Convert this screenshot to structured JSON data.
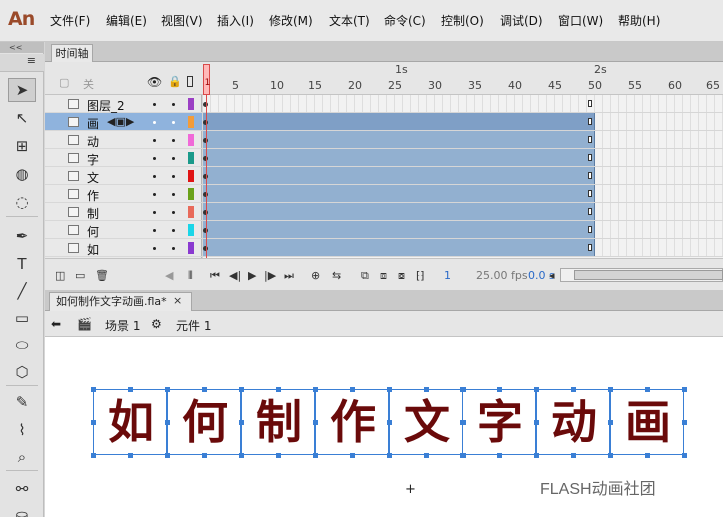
{
  "app": {
    "logo": "An"
  },
  "menu": [
    "文件(F)",
    "编辑(E)",
    "视图(V)",
    "插入(I)",
    "修改(M)",
    "文本(T)",
    "命令(C)",
    "控制(O)",
    "调试(D)",
    "窗口(W)",
    "帮助(H)"
  ],
  "toolbar": {
    "collapse": "<<",
    "grip": "≡",
    "tools": [
      {
        "name": "selection-tool-icon",
        "glyph": "➤",
        "selected": true
      },
      {
        "name": "subselection-tool-icon",
        "glyph": "↖"
      },
      {
        "name": "free-transform-tool-icon",
        "glyph": "⊞"
      },
      {
        "name": "3d-rotation-tool-icon",
        "glyph": "◍"
      },
      {
        "name": "lasso-tool-icon",
        "glyph": "◌"
      },
      {
        "name": "pen-tool-icon",
        "glyph": "✒"
      },
      {
        "name": "text-tool-icon",
        "glyph": "T"
      },
      {
        "name": "line-tool-icon",
        "glyph": "╱"
      },
      {
        "name": "rectangle-tool-icon",
        "glyph": "▭"
      },
      {
        "name": "oval-tool-icon",
        "glyph": "⬭"
      },
      {
        "name": "polystar-tool-icon",
        "glyph": "⬡"
      },
      {
        "name": "pencil-tool-icon",
        "glyph": "✎"
      },
      {
        "name": "brush-tool-icon",
        "glyph": "⌇"
      },
      {
        "name": "paint-brush-tool-icon",
        "glyph": "⌕"
      },
      {
        "name": "bone-tool-icon",
        "glyph": "⚯"
      },
      {
        "name": "paint-bucket-tool-icon",
        "glyph": "⛀"
      }
    ]
  },
  "timeline": {
    "tab": "时间轴",
    "header_label": "关",
    "ruler_seconds": [
      "1s",
      "2s"
    ],
    "ruler_frames": [
      "1",
      "5",
      "10",
      "15",
      "20",
      "25",
      "30",
      "35",
      "40",
      "45",
      "50",
      "55",
      "60",
      "65"
    ],
    "layers": [
      {
        "name": "图层_2",
        "color": "#9b3fc4",
        "active": false,
        "tween": false
      },
      {
        "name": "画",
        "color": "#f39c3a",
        "active": true,
        "tween": true
      },
      {
        "name": "动",
        "color": "#f06ad8",
        "active": false,
        "tween": true
      },
      {
        "name": "字",
        "color": "#1a9a8a",
        "active": false,
        "tween": true
      },
      {
        "name": "文",
        "color": "#e01414",
        "active": false,
        "tween": true
      },
      {
        "name": "作",
        "color": "#6aa11a",
        "active": false,
        "tween": true
      },
      {
        "name": "制",
        "color": "#e86a5a",
        "active": false,
        "tween": true
      },
      {
        "name": "何",
        "color": "#1ad6e8",
        "active": false,
        "tween": true
      },
      {
        "name": "如",
        "color": "#8a3ad0",
        "active": false,
        "tween": true
      }
    ],
    "current_frame": "1",
    "fps": "25.00 fps",
    "time": "0.0 s"
  },
  "document": {
    "tab": "如何制作文字动画.fla*",
    "close": "×",
    "scene": "场景 1",
    "symbol": "元件 1"
  },
  "stage": {
    "characters": [
      "如",
      "何",
      "制",
      "作",
      "文",
      "字",
      "动",
      "画"
    ]
  },
  "watermark": "FLASH动画社团",
  "cursor": "+"
}
